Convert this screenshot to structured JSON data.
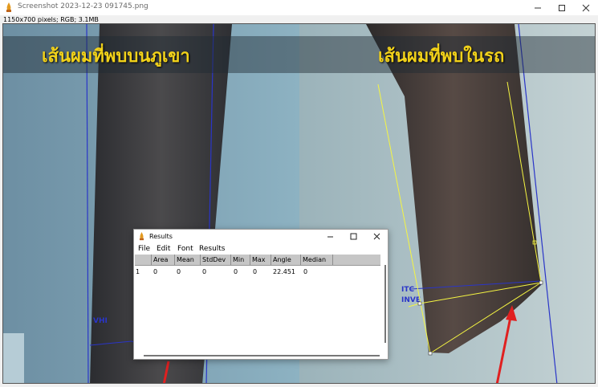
{
  "window": {
    "title": "Screenshot 2023-12-23 091745.png",
    "info": "1150x700 pixels; RGB; 3.1MB"
  },
  "image": {
    "caption_left": "เส้นผมที่พบบนภูเขา",
    "caption_right": "เส้นผมที่พบในรถ"
  },
  "results_dialog": {
    "title": "Results",
    "menu": [
      "File",
      "Edit",
      "Font",
      "Results"
    ],
    "columns": [
      "",
      "Area",
      "Mean",
      "StdDev",
      "Min",
      "Max",
      "Angle",
      "Median"
    ],
    "rows": [
      [
        "1",
        "0",
        "0",
        "0",
        "0",
        "0",
        "22.451",
        "0"
      ]
    ]
  },
  "colors": {
    "caption": "#f2d21a",
    "selection_line": "#f5f542",
    "annotation_blue": "#2a35c8",
    "arrow_red": "#e02020"
  }
}
